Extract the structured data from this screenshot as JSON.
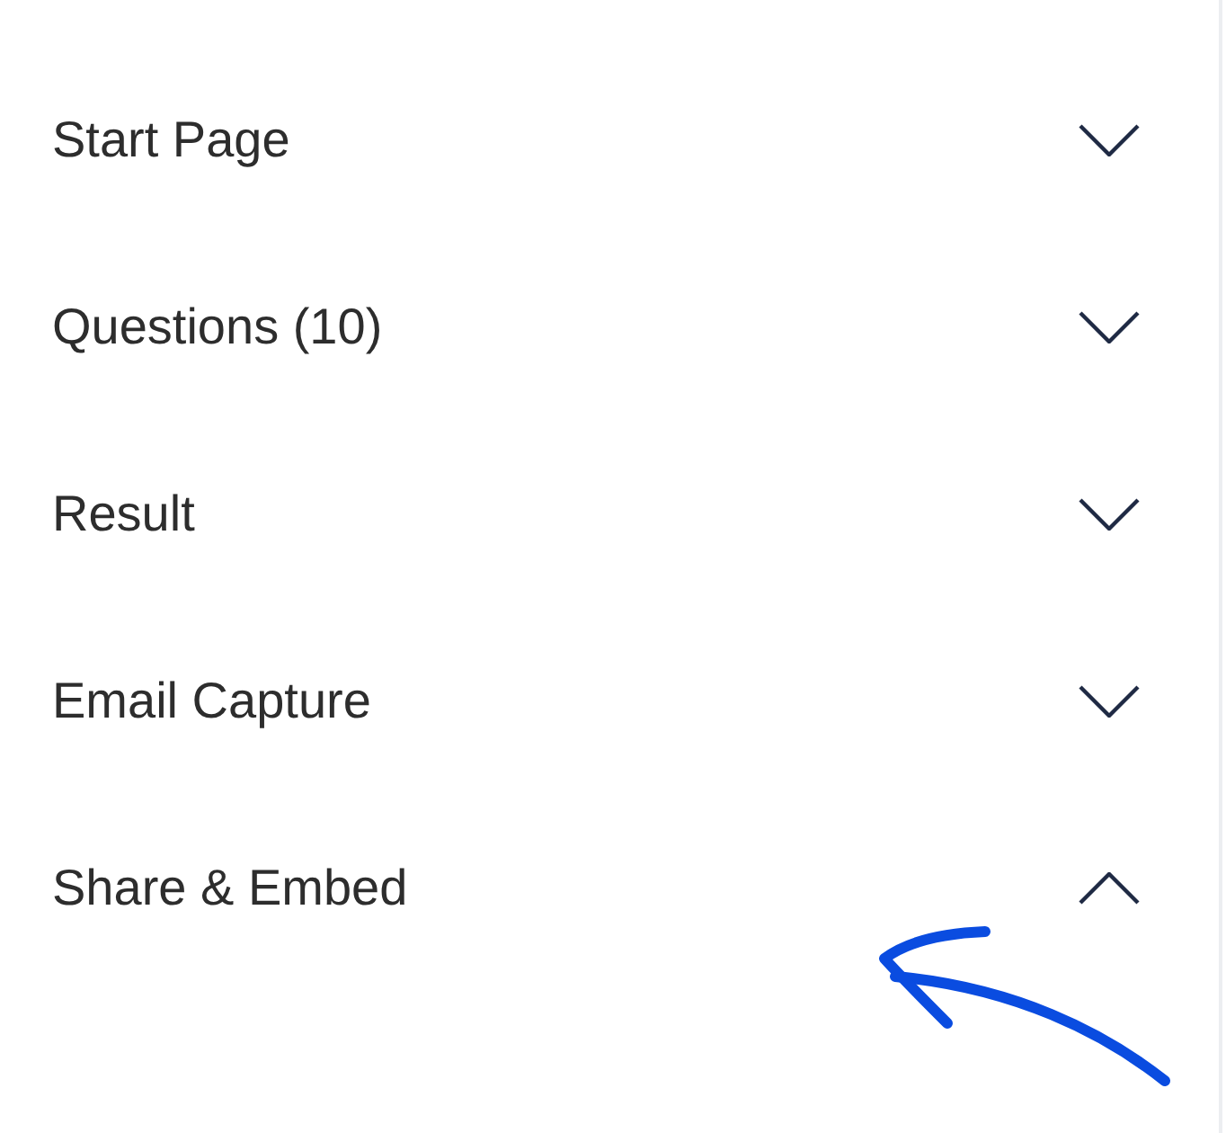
{
  "sections": [
    {
      "title": "Start Page",
      "expanded": false
    },
    {
      "title": "Questions (10)",
      "expanded": false
    },
    {
      "title": "Result",
      "expanded": false
    },
    {
      "title": "Email Capture",
      "expanded": false
    },
    {
      "title": "Share & Embed",
      "expanded": true
    }
  ]
}
